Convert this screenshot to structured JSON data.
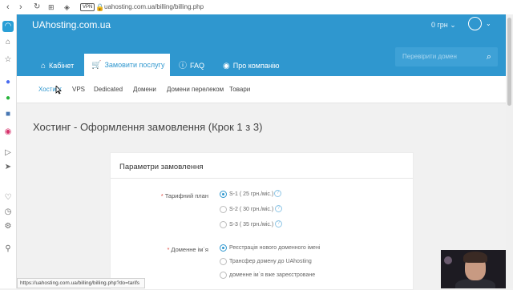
{
  "browser": {
    "url": "uahosting.com.ua/billing/billing.php",
    "vpn_badge": "VPN",
    "status_url": "https://uahosting.com.ua/billing/billing.php?do=tarifs"
  },
  "header": {
    "logo": "UAhosting.com.ua",
    "balance": "0 грн",
    "tabs": [
      {
        "label": "Кабінет"
      },
      {
        "label": "Замовити послугу"
      },
      {
        "label": "FAQ"
      },
      {
        "label": "Про компанію"
      }
    ],
    "search_placeholder": "Перевірити домен"
  },
  "subnav": {
    "items": [
      {
        "label": "Хостинг"
      },
      {
        "label": "VPS"
      },
      {
        "label": "Dedicated"
      },
      {
        "label": "Домени"
      },
      {
        "label": "Домени перелеком"
      },
      {
        "label": "Товари"
      }
    ]
  },
  "page": {
    "title": "Хостинг - Оформлення замовлення (Крок 1 з 3)"
  },
  "form": {
    "title": "Параметри замовлення",
    "tariff_label": "Тарифний план",
    "tariffs": [
      {
        "label": "S-1 ( 25 грн./міс.)",
        "selected": true
      },
      {
        "label": "S-2 ( 30 грн./міс.)",
        "selected": false
      },
      {
        "label": "S-3 ( 35 грн./міс.)",
        "selected": false
      }
    ],
    "domain_label": "Доменне ім`я",
    "domain_options": [
      {
        "label": "Реєстрація нового доменного імені",
        "selected": true
      },
      {
        "label": "Трансфер домену до UAhosting",
        "selected": false
      },
      {
        "label": "доменне ім`я вже зареєстроване",
        "selected": false
      }
    ]
  },
  "colors": {
    "brand": "#2f97cf",
    "required": "#e0473e"
  }
}
